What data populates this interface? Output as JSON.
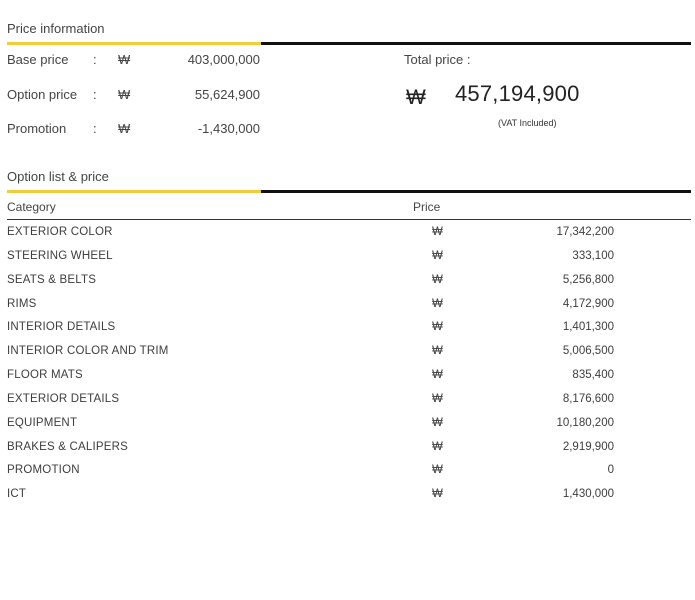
{
  "price_info": {
    "title": "Price information",
    "rows": [
      {
        "label": "Base price",
        "colon": ":",
        "currency": "₩",
        "amount": "403,000,000"
      },
      {
        "label": "Option price",
        "colon": ":",
        "currency": "₩",
        "amount": "55,624,900"
      },
      {
        "label": "Promotion",
        "colon": ":",
        "currency": "₩",
        "amount": "-1,430,000"
      }
    ],
    "total_label": "Total price  :",
    "total_currency": "₩",
    "total_value": "457,194,900",
    "vat_note": "(VAT Included)"
  },
  "option_list": {
    "title": "Option list & price",
    "col_category": "Category",
    "col_price": "Price",
    "rows": [
      {
        "category": "EXTERIOR COLOR",
        "currency": "₩",
        "price": "17,342,200"
      },
      {
        "category": "STEERING WHEEL",
        "currency": "₩",
        "price": "333,100"
      },
      {
        "category": "SEATS & BELTS",
        "currency": "₩",
        "price": "5,256,800"
      },
      {
        "category": "RIMS",
        "currency": "₩",
        "price": "4,172,900"
      },
      {
        "category": "INTERIOR DETAILS",
        "currency": "₩",
        "price": "1,401,300"
      },
      {
        "category": "INTERIOR COLOR AND TRIM",
        "currency": "₩",
        "price": "5,006,500"
      },
      {
        "category": "FLOOR MATS",
        "currency": "₩",
        "price": "835,400"
      },
      {
        "category": "EXTERIOR DETAILS",
        "currency": "₩",
        "price": "8,176,600"
      },
      {
        "category": "EQUIPMENT",
        "currency": "₩",
        "price": "10,180,200"
      },
      {
        "category": "BRAKES & CALIPERS",
        "currency": "₩",
        "price": "2,919,900"
      },
      {
        "category": "PROMOTION",
        "currency": "₩",
        "price": "0"
      },
      {
        "category": "ICT",
        "currency": "₩",
        "price": "1,430,000"
      }
    ]
  },
  "colors": {
    "accent": "#f0cd3a",
    "rule": "#111111"
  }
}
